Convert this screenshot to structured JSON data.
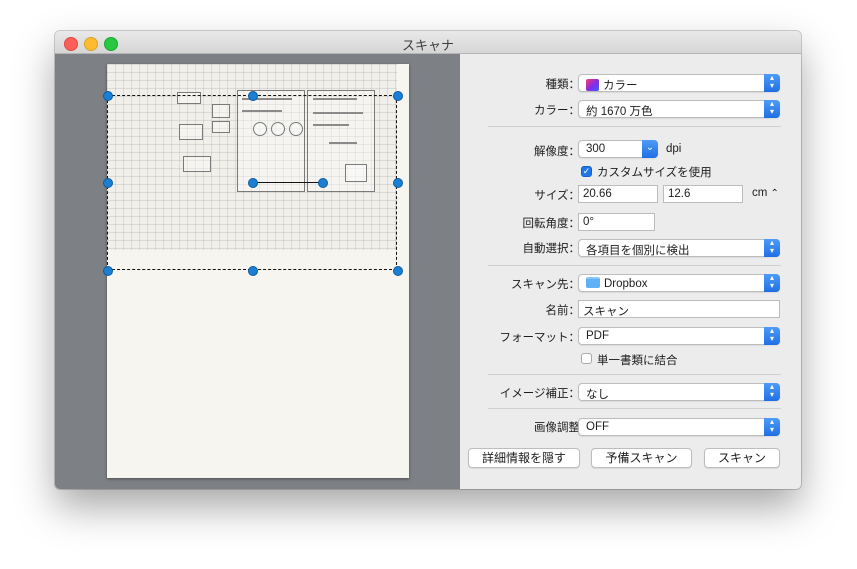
{
  "window": {
    "title": "スキャナ"
  },
  "settings": {
    "kind_label": "種類：",
    "kind_value": "カラー",
    "color_label": "カラー：",
    "color_value": "約 1670 万色",
    "resolution_label": "解像度：",
    "resolution_value": "300",
    "resolution_unit": "dpi",
    "custom_size_label": "カスタムサイズを使用",
    "custom_size_checked": true,
    "size_label": "サイズ：",
    "size_width": "20.66",
    "size_height": "12.6",
    "size_unit": "cm",
    "rotation_label": "回転角度：",
    "rotation_value": "0°",
    "auto_select_label": "自動選択：",
    "auto_select_value": "各項目を個別に検出",
    "destination_label": "スキャン先：",
    "destination_value": "Dropbox",
    "name_label": "名前：",
    "name_value": "スキャン",
    "format_label": "フォーマット：",
    "format_value": "PDF",
    "combine_label": "単一書類に結合",
    "combine_checked": false,
    "image_correction_label": "イメージ補正：",
    "image_correction_value": "なし",
    "image_adjust_label": "画像調整",
    "image_adjust_value": "OFF"
  },
  "buttons": {
    "hide_details": "詳細情報を隠す",
    "overview": "予備スキャン",
    "scan": "スキャン"
  },
  "icons": {
    "kind": "color-photo-icon",
    "destination": "folder-icon",
    "popup": "chevron-updown-icon"
  },
  "colors": {
    "accent": "#1f6fe5",
    "handle": "#1d7fd4"
  }
}
